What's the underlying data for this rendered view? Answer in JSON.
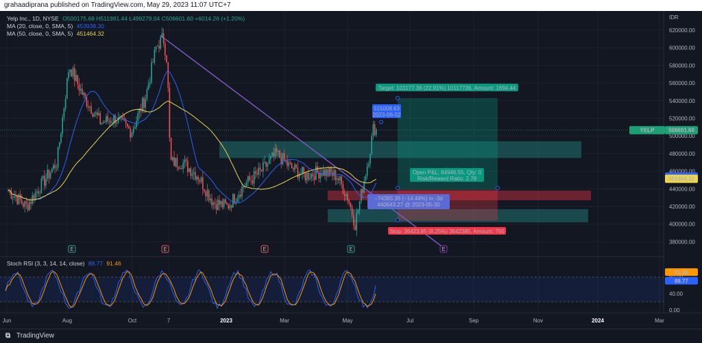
{
  "header": {
    "publisher": "grahaadiprana published on TradingView.com, May 29, 2023 11:07 UTC+7"
  },
  "legend": {
    "symbol": "Yelp Inc., 1D, NYSE",
    "ohlc": "O500175.68 H511981.44 L499279.04 C506601.60 +6014.26 (+1.20%)",
    "ma20_label": "MA (20, close, 0, SMA, 5)",
    "ma20_value": "453938.30",
    "ma50_label": "MA (50, close, 0, SMA, 5)",
    "ma50_value": "451464.32",
    "rsi_label": "Stoch RSI (3, 3, 14, 14, close)",
    "rsi_k": "88.77",
    "rsi_d": "91.46"
  },
  "colors": {
    "up": "#26a69a",
    "down": "#ef5350",
    "ma20": "#2962ff",
    "ma50": "#f0d646",
    "trendline": "#7e57c2",
    "rsi_k": "#2962ff",
    "rsi_d": "#ff9800",
    "target": "#089981",
    "stop": "#f23645",
    "price_tag": "#1e9f73"
  },
  "price_axis": {
    "currency": "IDR",
    "ticks": [
      "620000.00",
      "600000.00",
      "580000.00",
      "560000.00",
      "540000.00",
      "520000.00",
      "500000.00",
      "480000.00",
      "460000.00",
      "440000.00",
      "420000.00",
      "400000.00",
      "380000.00"
    ],
    "last_price_symbol": "YELP",
    "last_price": "506601.60",
    "ma20_tag": "453938.30",
    "ma50_tag": "451464.32"
  },
  "rsi_axis": {
    "ticks": [
      "80.00",
      "40.00",
      "0.00"
    ],
    "tag_d": "91.46",
    "tag_k": "88.77"
  },
  "time_axis": [
    "Jun",
    "Aug",
    "Oct",
    "7",
    "2023",
    "Mar",
    "May",
    "Jul",
    "Sep",
    "Nov",
    "2024",
    "Mar"
  ],
  "annotations": {
    "target": "Target: 101177.36 (22.91%) 10117736, Amount: 1694.44",
    "stop": "Stop: 36423.85 (8.25%) 3642385, Amount: 750",
    "open_pl_line1": "Open P&L: 64946.55, Qty: 0",
    "open_pl_line2": "Risk/Reward Ratio: 2.78",
    "price_callout_value": "515008.63",
    "price_callout_date": "2023-06-02",
    "range_line1": "−74365.36 (−14.44%) in -3d",
    "range_line2": "440643.27 @ 2023-05-30"
  },
  "event_markers": [
    "E",
    "E",
    "E",
    "E",
    "E"
  ],
  "footer": {
    "brand": "TradingView"
  },
  "chart_data": {
    "type": "candlestick",
    "title": "Yelp Inc., 1D, NYSE",
    "ylabel": "IDR",
    "ylim": [
      370000,
      625000
    ],
    "grid": true,
    "x_range": [
      "2022-06",
      "2024-03"
    ],
    "series": [
      {
        "name": "MA (20, close, 0, SMA, 5)",
        "last": 453938.3
      },
      {
        "name": "MA (50, close, 0, SMA, 5)",
        "last": 451464.32
      }
    ],
    "approx_closes": [
      {
        "x": "2022-06-01",
        "y": 440000
      },
      {
        "x": "2022-06-20",
        "y": 420000
      },
      {
        "x": "2022-07-05",
        "y": 445000
      },
      {
        "x": "2022-07-20",
        "y": 470000
      },
      {
        "x": "2022-08-01",
        "y": 580000
      },
      {
        "x": "2022-08-15",
        "y": 545000
      },
      {
        "x": "2022-09-01",
        "y": 515000
      },
      {
        "x": "2022-09-15",
        "y": 520000
      },
      {
        "x": "2022-10-01",
        "y": 505000
      },
      {
        "x": "2022-10-15",
        "y": 545000
      },
      {
        "x": "2022-10-25",
        "y": 600000
      },
      {
        "x": "2022-11-01",
        "y": 612000
      },
      {
        "x": "2022-11-05",
        "y": 585000
      },
      {
        "x": "2022-11-08",
        "y": 470000
      },
      {
        "x": "2022-11-20",
        "y": 470000
      },
      {
        "x": "2022-12-05",
        "y": 455000
      },
      {
        "x": "2022-12-20",
        "y": 425000
      },
      {
        "x": "2023-01-03",
        "y": 420000
      },
      {
        "x": "2023-01-20",
        "y": 445000
      },
      {
        "x": "2023-02-05",
        "y": 460000
      },
      {
        "x": "2023-02-20",
        "y": 480000
      },
      {
        "x": "2023-03-05",
        "y": 465000
      },
      {
        "x": "2023-03-20",
        "y": 455000
      },
      {
        "x": "2023-04-05",
        "y": 460000
      },
      {
        "x": "2023-04-20",
        "y": 455000
      },
      {
        "x": "2023-05-01",
        "y": 430000
      },
      {
        "x": "2023-05-08",
        "y": 400000
      },
      {
        "x": "2023-05-15",
        "y": 440000
      },
      {
        "x": "2023-05-22",
        "y": 480000
      },
      {
        "x": "2023-05-26",
        "y": 510000
      },
      {
        "x": "2023-05-29",
        "y": 506601.6
      }
    ],
    "stoch_rsi": {
      "k": 88.77,
      "d": 91.46,
      "ylim": [
        0,
        100
      ],
      "bands": [
        20,
        80
      ]
    }
  }
}
